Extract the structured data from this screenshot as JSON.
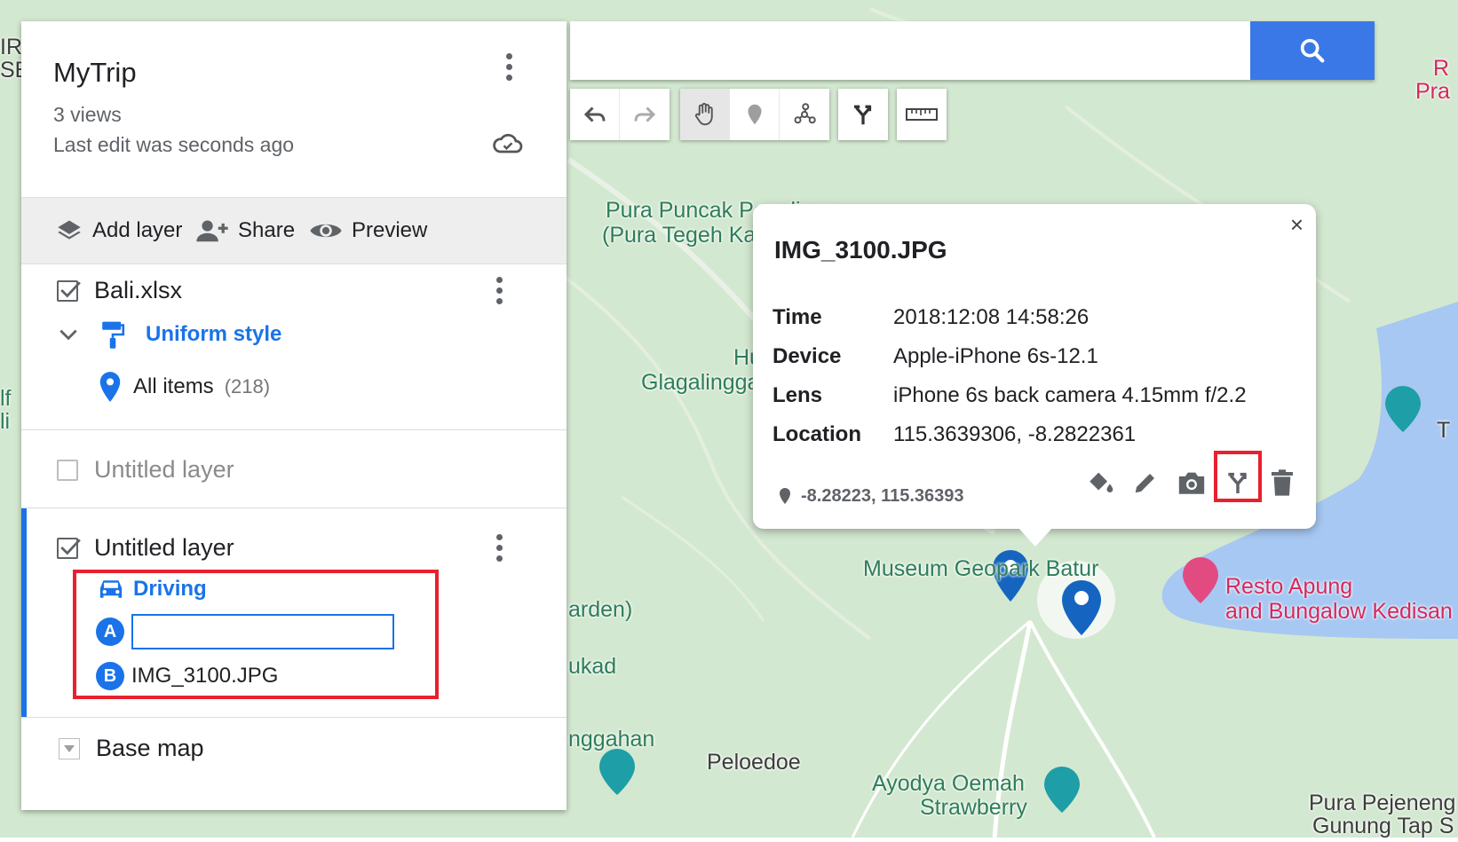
{
  "panel": {
    "title": "MyTrip",
    "views": "3 views",
    "last_edit": "Last edit was seconds ago",
    "toolbar": {
      "add_layer": "Add layer",
      "share": "Share",
      "preview": "Preview"
    },
    "layers": [
      {
        "name": "Bali.xlsx",
        "checked": true,
        "style": "Uniform style",
        "items_label": "All items",
        "items_count": "(218)"
      },
      {
        "name": "Untitled layer",
        "checked": false
      },
      {
        "name": "Untitled layer",
        "checked": true,
        "mode": "Driving",
        "a_label": "A",
        "a_value": "",
        "b_label": "B",
        "b_value": "IMG_3100.JPG"
      }
    ],
    "base_map": "Base map"
  },
  "search": {
    "value": "",
    "placeholder": ""
  },
  "popup": {
    "title": "IMG_3100.JPG",
    "fields": [
      {
        "key": "Time",
        "value": "2018:12:08 14:58:26"
      },
      {
        "key": "Device",
        "value": "Apple-iPhone 6s-12.1"
      },
      {
        "key": "Lens",
        "value": "iPhone 6s back camera 4.15mm f/2.2"
      },
      {
        "key": "Location",
        "value": "115.3639306, -8.2822361"
      }
    ],
    "coords": "-8.28223, 115.36393",
    "close": "×"
  },
  "map_labels": {
    "pura_puncak_1": "Pura Puncak Penulisan",
    "pura_puncak_2": "(Pura Tegeh Kahu",
    "hutan": "Hutan",
    "glagalinggah": "Glagalinggah",
    "museum": "Museum Geopark Batur",
    "resto_1": "Resto Apung",
    "resto_2": "and Bungalow Kedisan",
    "arden": "arden)",
    "ukad": "ukad",
    "nggahan": "nggahan",
    "peloedoe": "Peloedoe",
    "ayodya_1": "Ayodya Oemah",
    "ayodya_2": "Strawberry",
    "pura_pejeneng_1": "Pura Pejeneng",
    "pura_pejeneng_2": "Gunung Tap S",
    "edge_r": "R",
    "edge_pra": "Pra",
    "edge_ir": "IR",
    "edge_se": "SE",
    "edge_t": "T",
    "edge_lf": "lf",
    "edge_li": "li"
  },
  "colors": {
    "accent": "#1a73e8",
    "highlight": "#e8202f",
    "search_button": "#3b78e7",
    "map_bg": "#cfe6cf"
  }
}
